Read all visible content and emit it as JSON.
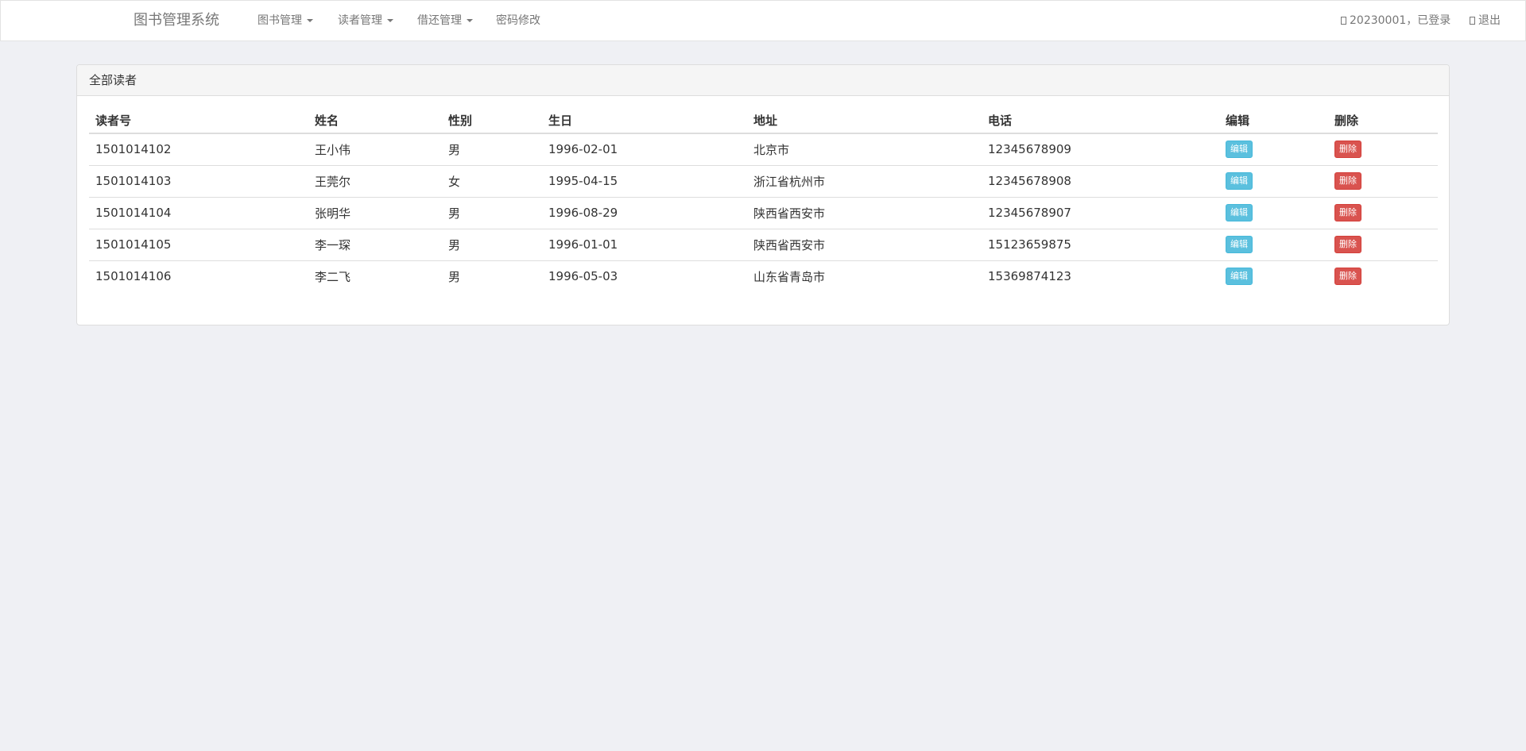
{
  "nav": {
    "brand": "图书管理系统",
    "menu": [
      {
        "label": "图书管理"
      },
      {
        "label": "读者管理"
      },
      {
        "label": "借还管理"
      },
      {
        "label": "密码修改"
      }
    ],
    "user_status": "20230001，已登录",
    "logout": "退出"
  },
  "panel": {
    "title": "全部读者",
    "columns": [
      "读者号",
      "姓名",
      "性别",
      "生日",
      "地址",
      "电话",
      "编辑",
      "删除"
    ],
    "rows": [
      {
        "id": "1501014102",
        "name": "王小伟",
        "sex": "男",
        "birth": "1996-02-01",
        "address": "北京市",
        "phone": "12345678909"
      },
      {
        "id": "1501014103",
        "name": "王莞尔",
        "sex": "女",
        "birth": "1995-04-15",
        "address": "浙江省杭州市",
        "phone": "12345678908"
      },
      {
        "id": "1501014104",
        "name": "张明华",
        "sex": "男",
        "birth": "1996-08-29",
        "address": "陕西省西安市",
        "phone": "12345678907"
      },
      {
        "id": "1501014105",
        "name": "李一琛",
        "sex": "男",
        "birth": "1996-01-01",
        "address": "陕西省西安市",
        "phone": "15123659875"
      },
      {
        "id": "1501014106",
        "name": "李二飞",
        "sex": "男",
        "birth": "1996-05-03",
        "address": "山东省青岛市",
        "phone": "15369874123"
      }
    ],
    "edit_label": "编辑",
    "delete_label": "删除"
  },
  "colors": {
    "edit_button": "#5bc0de",
    "delete_button": "#d9534f",
    "background": "#eff0f4"
  }
}
